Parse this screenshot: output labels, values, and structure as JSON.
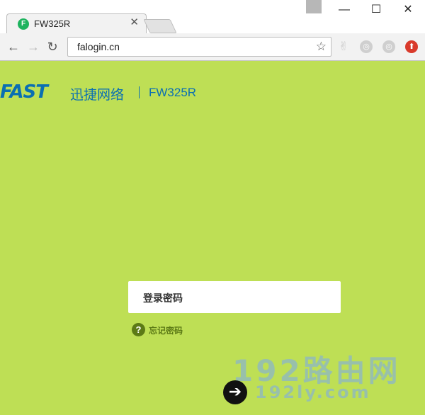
{
  "browser": {
    "tab_title": "FW325R",
    "tab_favicon": "F",
    "tab_close": "✕",
    "url": "falogin.cn",
    "window_controls": {
      "minimize": "—",
      "maximize": "☐",
      "close": "✕"
    },
    "icons": {
      "back": "←",
      "forward": "→",
      "reload": "↻",
      "star": "☆",
      "ext_1": "✌",
      "ext_2": "◎",
      "ext_3": "◎",
      "ext_4": "⬆"
    }
  },
  "page": {
    "brand_logo": "FAST",
    "brand_cn": "迅捷网络",
    "brand_model": "FW325R",
    "password_placeholder": "登录密码",
    "forgot_icon": "?",
    "forgot_label": "忘记密码",
    "submit_icon": "➔",
    "watermark_big": "192路由网",
    "watermark_small": "192ly.com"
  },
  "colors": {
    "page_bg": "#bedf55",
    "brand_blue": "#0a6fb2",
    "forgot_green": "#5c7a16"
  }
}
